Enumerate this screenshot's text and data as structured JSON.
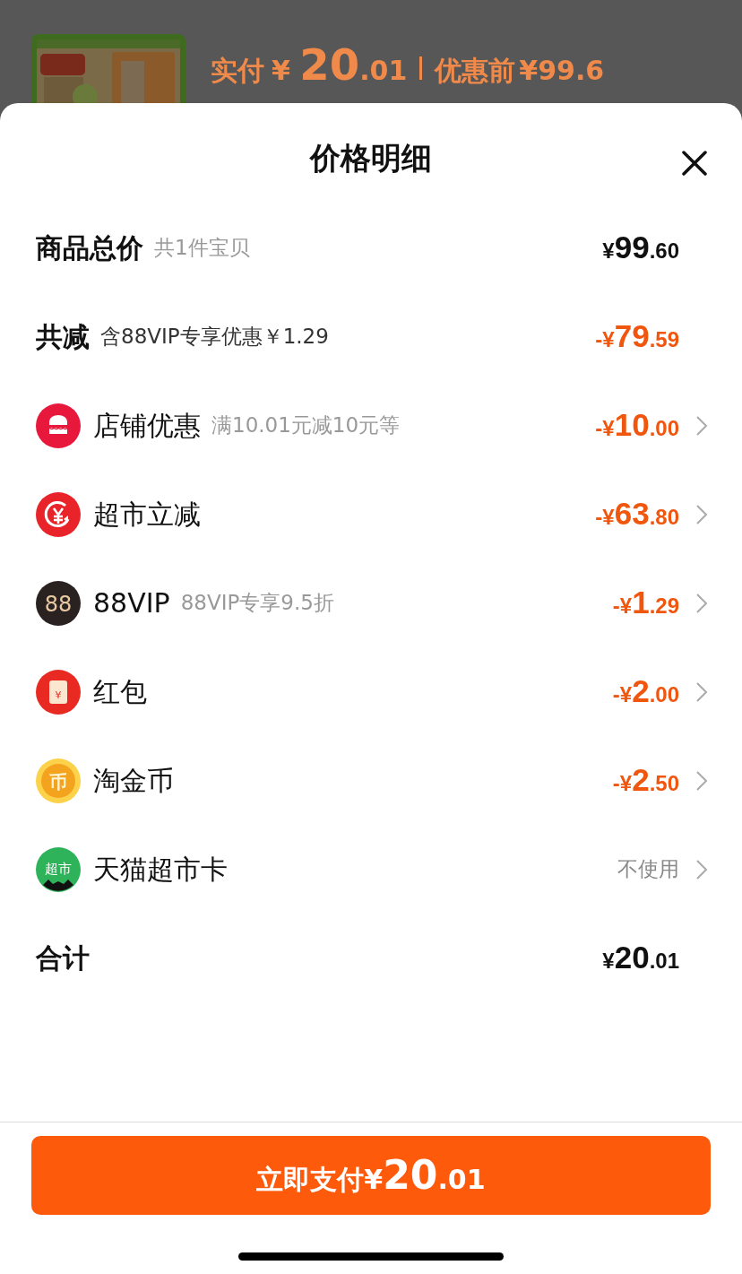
{
  "background": {
    "paid_label": "实付",
    "paid_amount": "¥ 20.01",
    "before_label": "优惠前",
    "before_amount": "¥99.6"
  },
  "sheet": {
    "title": "价格明细",
    "rows": [
      {
        "kind": "summary",
        "label": "商品总价",
        "note": "共1件宝贝",
        "amount": "¥99.60",
        "discount": false
      },
      {
        "kind": "summary",
        "label": "共减",
        "note": "含88VIP专享优惠￥1.29",
        "amount": "-¥79.59",
        "discount": true,
        "dark_note": true
      },
      {
        "kind": "item",
        "label": "店铺优惠",
        "note": "满10.01元减10元等",
        "amount": "-¥10.00",
        "discount": true
      },
      {
        "kind": "item",
        "label": "超市立减",
        "amount": "-¥63.80",
        "discount": true
      },
      {
        "kind": "item",
        "icon_text": "88",
        "label": "88VIP",
        "note": "88VIP专享9.5折",
        "amount": "-¥1.29",
        "discount": true
      },
      {
        "kind": "item",
        "icon_text": "¥",
        "label": "红包",
        "amount": "-¥2.00",
        "discount": true
      },
      {
        "kind": "item",
        "icon_text": "币",
        "label": "淘金币",
        "amount": "-¥2.50",
        "discount": true
      },
      {
        "kind": "item",
        "icon_text": "超市",
        "label": "天猫超市卡",
        "status": "不使用"
      },
      {
        "kind": "summary",
        "label": "合计",
        "amount": "¥20.01",
        "discount": false
      }
    ],
    "pay_button": {
      "label": "立即支付",
      "amount": "¥20.01"
    }
  }
}
